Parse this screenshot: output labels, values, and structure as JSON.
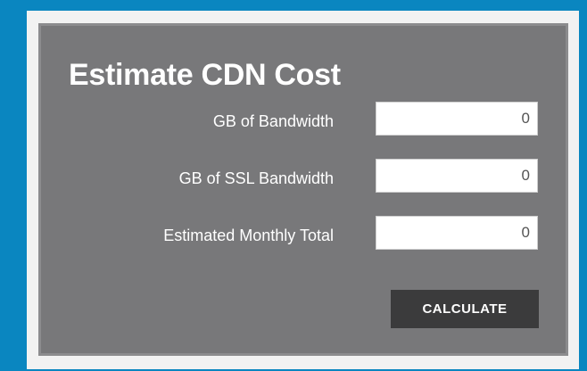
{
  "calculator": {
    "title": "Estimate CDN Cost",
    "fields": [
      {
        "label": "GB of Bandwidth",
        "value": "0"
      },
      {
        "label": "GB of SSL Bandwidth",
        "value": "0"
      },
      {
        "label": "Estimated Monthly Total",
        "value": "0"
      }
    ],
    "calculate_label": "CALCULATE"
  },
  "colors": {
    "page_background": "#0a86c0",
    "frame": "#f2f2f2",
    "panel": "#78787a",
    "button": "#3b3b3c"
  }
}
